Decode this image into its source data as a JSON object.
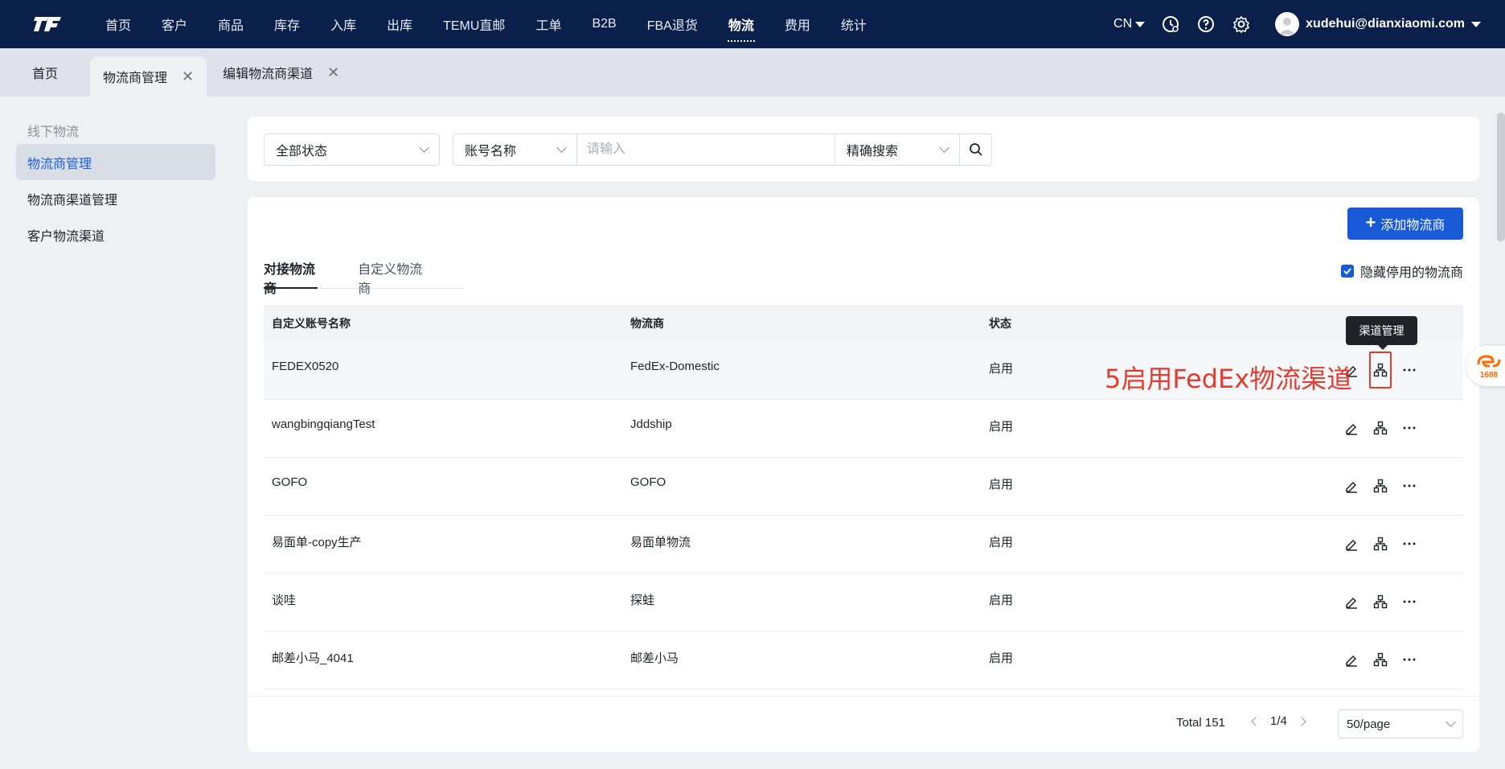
{
  "nav": {
    "items": [
      "首页",
      "客户",
      "商品",
      "库存",
      "入库",
      "出库",
      "TEMU直邮",
      "工单",
      "B2B",
      "FBA退货",
      "物流",
      "费用",
      "统计"
    ],
    "active_index": 10,
    "lang": "CN",
    "user": "xudehui@dianxiaomi.com"
  },
  "page_tabs": [
    {
      "label": "首页"
    },
    {
      "label": "物流商管理"
    },
    {
      "label": "编辑物流商渠道"
    }
  ],
  "sidebar": {
    "heading": "线下物流",
    "items": [
      {
        "label": "物流商管理"
      },
      {
        "label": "物流商渠道管理"
      },
      {
        "label": "客户物流渠道"
      }
    ]
  },
  "filter": {
    "status_select": "全部状态",
    "field_select": "账号名称",
    "search_placeholder": "请输入",
    "mode_select": "精确搜索"
  },
  "main": {
    "add_button": "添加物流商",
    "tabs": [
      "对接物流商",
      "自定义物流商"
    ],
    "hide_disabled_label": "隐藏停用的物流商",
    "hide_disabled_checked": true
  },
  "table": {
    "headers": [
      "自定义账号名称",
      "物流商",
      "状态"
    ],
    "rows": [
      [
        "FEDEX0520",
        "FedEx-Domestic",
        "启用"
      ],
      [
        "wangbingqiangTest",
        "Jddship",
        "启用"
      ],
      [
        "GOFO",
        "GOFO",
        "启用"
      ],
      [
        "易面单-copy生产",
        "易面单物流",
        "启用"
      ],
      [
        "谈哇",
        "探蛙",
        "启用"
      ],
      [
        "邮差小马_4041",
        "邮差小马",
        "启用"
      ]
    ]
  },
  "tooltip": "渠道管理",
  "annotation": "5启用FedEx物流渠道",
  "pagination": {
    "total": "Total 151",
    "page": "1/4",
    "page_size": "50/page"
  },
  "badge": "1688",
  "colors": {
    "nav_bg": "#0b1f4b",
    "primary": "#1759d6",
    "annotation": "#e33b2e"
  }
}
